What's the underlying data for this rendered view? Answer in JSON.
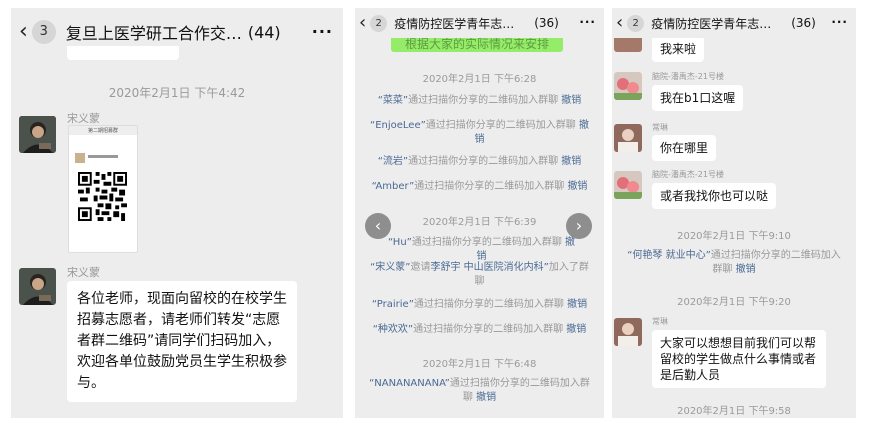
{
  "panel1": {
    "back_count": "3",
    "title": "复旦上医学研工合作交…",
    "member_count": "(44)",
    "more": "···",
    "timestamp": "2020年2月1日 下午4:42",
    "msg1": {
      "sender": "宋义蒙",
      "qr_caption": "第二期招募群"
    },
    "msg2": {
      "sender": "宋义蒙",
      "text": "各位老师，现面向留校的在校学生招募志愿者，请老师们转发“志愿者群二维码”请同学们扫码加入，欢迎各单位鼓励党员生学生积极参与。"
    }
  },
  "panel2": {
    "back_count": "2",
    "title": "疫情防控医学青年志愿…",
    "member_count": "(36)",
    "more": "···",
    "top_bubble_text": "根据大家的实际情况来安排",
    "time1": "2020年2月1日 下午6:28",
    "time2": "2020年2月1日 下午6:39",
    "time3": "2020年2月1日 下午6:48",
    "revoke": "撤销",
    "join_suffix": "通过扫描你分享的二维码加入群聊",
    "invite_mid": "邀请",
    "invite_suffix": "加入了群聊",
    "nav_prev": "‹",
    "nav_next": "›",
    "events": [
      {
        "name": "“菜菜”"
      },
      {
        "name": "“EnjoeLee”"
      },
      {
        "name": "“流岩”"
      },
      {
        "name": "“Amber”"
      },
      {
        "name": "“Hu”"
      },
      {
        "inviter": "“宋义蒙”",
        "invitee": "李舒宇 中山医院消化内科”"
      },
      {
        "name": "“Prairie”"
      },
      {
        "name": "“种欢欢”"
      },
      {
        "name": "“NANANANANA”"
      }
    ]
  },
  "panel3": {
    "back_count": "2",
    "title": "疫情防控医学青年志愿…",
    "member_count": "(36)",
    "more": "···",
    "m1": "我来啦",
    "m2_sender": "脑院-潘禹杰-21号楼",
    "m2": "我在b1口这喔",
    "m3_sender": "常琳",
    "m3": "你在哪里",
    "m4_sender": "脑院-潘禹杰-21号楼",
    "m4": "或者我找你也可以哒",
    "time1": "2020年2月1日 下午9:10",
    "sys_name": "“何艳琴 就业中心”",
    "sys_suffix": "通过扫描你分享的二维码加入群聊",
    "revoke": "撤销",
    "time2": "2020年2月1日 下午9:20",
    "m5_sender": "常琳",
    "m5": "大家可以想想目前我们可以帮留校的学生做点什么事情或者是后勤人员",
    "time3": "2020年2月1日 下午9:58"
  },
  "colors": {
    "bg": "#ededed",
    "link": "#4a6a94",
    "system_text": "#999999",
    "bubble": "#ffffff"
  }
}
